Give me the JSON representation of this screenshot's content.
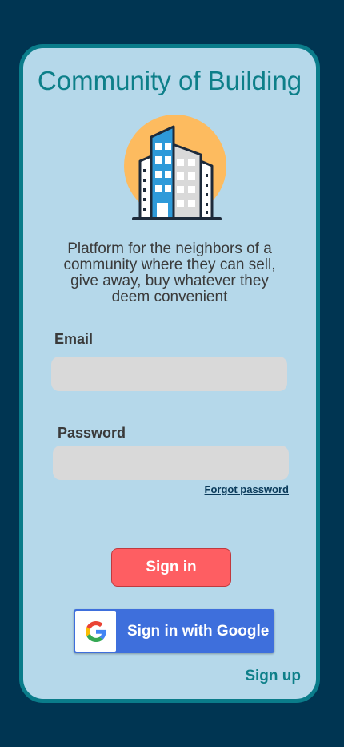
{
  "app": {
    "title": "Community of Building",
    "description": "Platform for the neighbors of a community where they can sell, give away, buy whatever they deem convenient"
  },
  "form": {
    "email_label": "Email",
    "email_value": "",
    "password_label": "Password",
    "password_value": "",
    "forgot_password_label": "Forgot password",
    "sign_in_label": "Sign in",
    "google_sign_in_label": "Sign in with Google",
    "sign_up_label": "Sign up"
  },
  "icons": {
    "logo": "building-logo-icon",
    "google": "google-g-icon"
  },
  "colors": {
    "background": "#003552",
    "card": "#b5d8ea",
    "card_border": "#0a7c8a",
    "title": "#0d7f89",
    "input": "#d9d9d9",
    "sign_in_button": "#fe5e62",
    "google_button": "#3e6fdc"
  }
}
